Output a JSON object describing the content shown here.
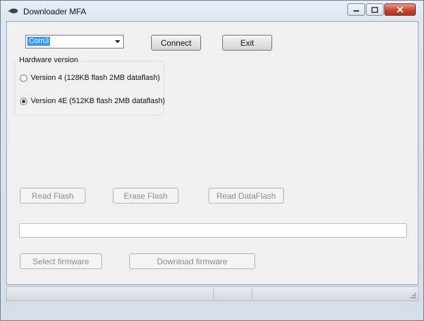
{
  "window": {
    "title": "Downloader MFA",
    "icon": "mouse-icon"
  },
  "connection": {
    "port_selected": "Com3",
    "connect_label": "Connect",
    "exit_label": "Exit"
  },
  "hardware": {
    "group_label": "Hardware version",
    "options": [
      {
        "label": "Version 4 (128KB  flash 2MB dataflash)",
        "checked": false
      },
      {
        "label": "Version 4E (512KB flash 2MB dataflash)",
        "checked": true
      }
    ]
  },
  "actions": {
    "read_flash": "Read Flash",
    "erase_flash": "Erase Flash",
    "read_dataflash": "Read DataFlash",
    "select_firmware": "Select firmware",
    "download_firmware": "Download firmware"
  },
  "progress": {
    "value": 0
  },
  "colors": {
    "accent_selection": "#3399ff",
    "close_button": "#c9452f",
    "progress_fill": "#06b025"
  }
}
